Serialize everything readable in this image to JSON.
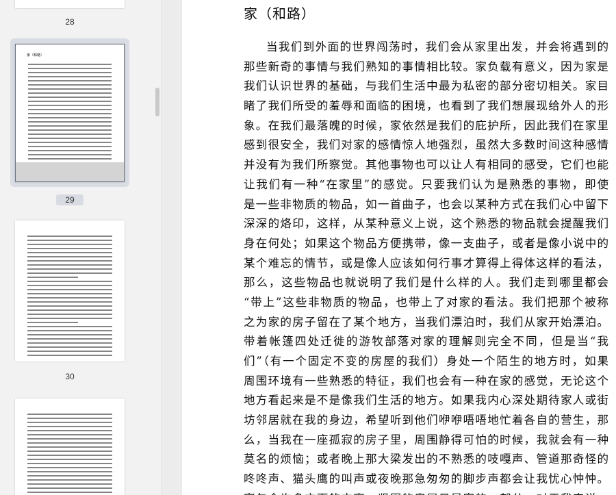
{
  "sidebar": {
    "thumbnails": [
      {
        "page_label": "28"
      },
      {
        "page_label": "29",
        "mini_title": "家（和路）",
        "selected": true
      },
      {
        "page_label": "30"
      },
      {
        "page_label": ""
      }
    ]
  },
  "document": {
    "title": "家（和路）",
    "lines": [
      "当我们到外面的世界闯荡时，我们会从家里出发，并会将遇到的",
      "那些新奇的事情与我们熟知的事情相比较。家负载有意义，因为家是",
      "我们认识世界的基础，与我们生活中最为私密的部分密切相关。家目",
      "睹了我们所受的羞辱和面临的困境，也看到了我们想展现给外人的形",
      "象。在我们最落魄的时候，家依然是我们的庇护所，因此我们在家里",
      "感到很安全，我们对家的感情惊人地强烈，虽然大多数时间这种感情",
      "并没有为我们所察觉。其他事物也可以让人有相同的感受，它们也能",
      "让我们有一种“在家里”的感觉。只要我们认为是熟悉的事物，即使",
      "是一些非物质的物品，如一首曲子，也会以某种方式在我们心中留下",
      "深深的烙印，这样，从某种意义上说，这个熟悉的物品就会提醒我们",
      "身在何处；如果这个物品方便携带，像一支曲子，或者是像小说中的",
      "某个难忘的情节，或是像人应该如何行事才算得上得体这样的看法，",
      "那么，这些物品也就说明了我们是什么样的人。我们走到哪里都会",
      "“带上”这些非物质的物品，也带上了对家的看法。我们把那个被称",
      "之为家的房子留在了某个地方，当我们漂泊时，我们从家开始漂泊。",
      "带着帐篷四处迁徙的游牧部落对家的理解则完全不同，但是当“我",
      "们”（有一个固定不变的房屋的我们）身处一个陌生的地方时，如果",
      "周围环境有一些熟悉的特征，我们也会有一种在家的感觉，无论这个",
      "地方看起来是不是像我们生活的地方。如果我内心深处期待家人或街",
      "坊邻居就在我的身边，希望听到他们咿咿唔唔地忙着各自的营生，那",
      "么，当我在一座孤寂的房子里，周围静得可怕的时候，我就会有一种",
      "莫名的烦恼；或者晚上那大梁发出的不熟悉的吱嘎声、管道那奇怪的",
      "咚咚声、猫头鹰的叫声或夜晚那急匆匆的脚步声都会让我忧心忡忡。",
      "家包含许多方面的内容，坚固的房屋只是家的一部分。对于我来说，"
    ]
  }
}
